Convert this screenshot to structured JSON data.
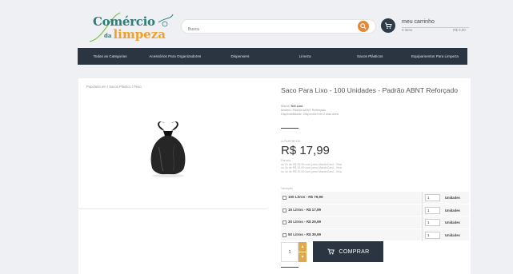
{
  "header": {
    "logo_line1": "Comércio",
    "logo_line2_prefix": "da",
    "logo_line2": "limpeza",
    "search_placeholder": "Busca",
    "cart": {
      "title": "meu carrinho",
      "items": "0 itens",
      "total": "R$ 0,00"
    }
  },
  "nav": {
    "items": [
      "Todas as Categorias",
      "Acessórios Para Organizadores",
      "Dispensers",
      "Limeza",
      "Sacos Plásticos",
      "Equipamentos Para Limpeza"
    ]
  },
  "product": {
    "breadcrumb": "Papelaria em / Sacos Plástico / Peso",
    "title": "Saco Para Lixo - 100 Unidades - Padrão ABNT Reforçado",
    "meta": {
      "brand_label": "Marca:",
      "brand": "Kill Lixo",
      "model_label": "Modelo:",
      "model": "Padrão ABNT Reforçado",
      "availability_label": "Disponibilidade:",
      "availability": "Disponível em 2 dias úteis"
    },
    "price_label": "A PARTIR DE",
    "price": "R$ 17,99",
    "installments": {
      "header": "Parcela",
      "lines": [
        "ou 2x de R$ 35,99 com juros MasterCard - Visa",
        "ou 3x de R$ 14,00 com juros MasterCard - Visa",
        "ou 4x de R$ 10,00 com juros MasterCard - Visa"
      ]
    },
    "variation_label": "Variação",
    "variations": [
      {
        "label": "100 Litros - R$ 79,99",
        "qty": "1",
        "unit": "Unidades"
      },
      {
        "label": "15 Litros - R$ 17,99",
        "qty": "1",
        "unit": "Unidades"
      },
      {
        "label": "30 Litros - R$ 29,99",
        "qty": "1",
        "unit": "Unidades"
      },
      {
        "label": "50 Litros - R$ 39,99",
        "qty": "1",
        "unit": "Unidades"
      }
    ],
    "quantity": "1",
    "buy_label": "COMPRAR"
  },
  "colors": {
    "nav_bg": "#2b3441",
    "accent_orange": "#e08a3c",
    "logo_teal": "#2e7d7a",
    "logo_orange": "#f0a02a"
  },
  "icons": [
    "search-icon",
    "cart-icon",
    "trash-bag-product-image",
    "cart-button-icon",
    "increment-icon",
    "decrement-icon"
  ]
}
